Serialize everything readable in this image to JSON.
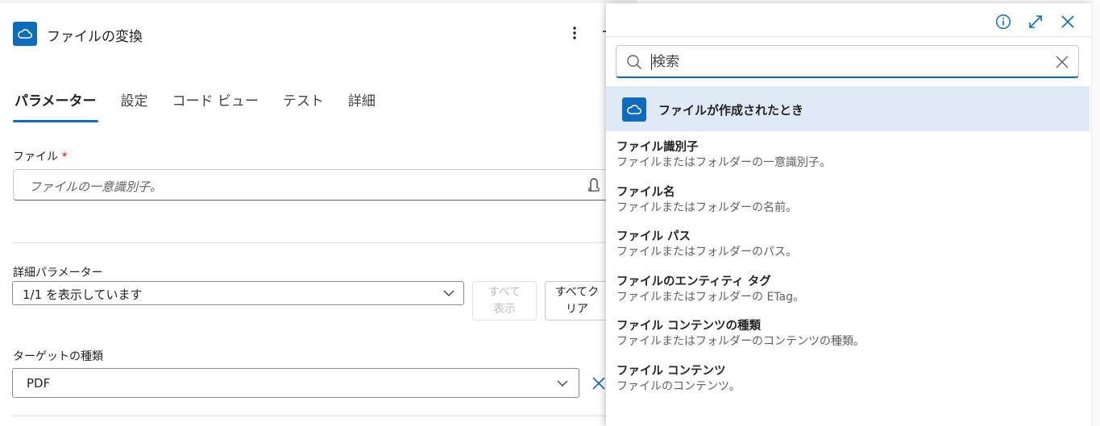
{
  "header": {
    "title": "ファイルの変換",
    "more_icon": "more-vertical-icon",
    "app_icon": "onedrive-cloud-icon"
  },
  "tabs": [
    {
      "label": "パラメーター",
      "active": true
    },
    {
      "label": "設定",
      "active": false
    },
    {
      "label": "コード ビュー",
      "active": false
    },
    {
      "label": "テスト",
      "active": false
    },
    {
      "label": "詳細",
      "active": false
    }
  ],
  "file_field": {
    "label": "ファイル",
    "required_mark": "*",
    "placeholder": "ファイルの一意識別子。"
  },
  "advanced": {
    "label": "詳細パラメーター",
    "selected": "1/1 を表示しています",
    "show_all_line1": "すべて",
    "show_all_line2": "表示",
    "clear_all_line1": "すべてク",
    "clear_all_line2": "リア"
  },
  "target": {
    "label": "ターゲットの種類",
    "selected": "PDF"
  },
  "popup": {
    "search_placeholder": "検索",
    "header_icons": [
      "info-icon",
      "expand-icon",
      "close-icon"
    ],
    "section_title": "ファイルが作成されたとき",
    "items": [
      {
        "name": "ファイル識別子",
        "desc": "ファイルまたはフォルダーの一意識別子。"
      },
      {
        "name": "ファイル名",
        "desc": "ファイルまたはフォルダーの名前。"
      },
      {
        "name": "ファイル パス",
        "desc": "ファイルまたはフォルダーのパス。"
      },
      {
        "name": "ファイルのエンティティ タグ",
        "desc": "ファイルまたはフォルダーの ETag。"
      },
      {
        "name": "ファイル コンテンツの種類",
        "desc": "ファイルまたはフォルダーのコンテンツの種類。"
      },
      {
        "name": "ファイル コンテンツ",
        "desc": "ファイルのコンテンツ。"
      }
    ]
  },
  "colors": {
    "accent": "#0f6cbd",
    "section_bg": "#dfeaf6",
    "required": "#c50f1f"
  }
}
